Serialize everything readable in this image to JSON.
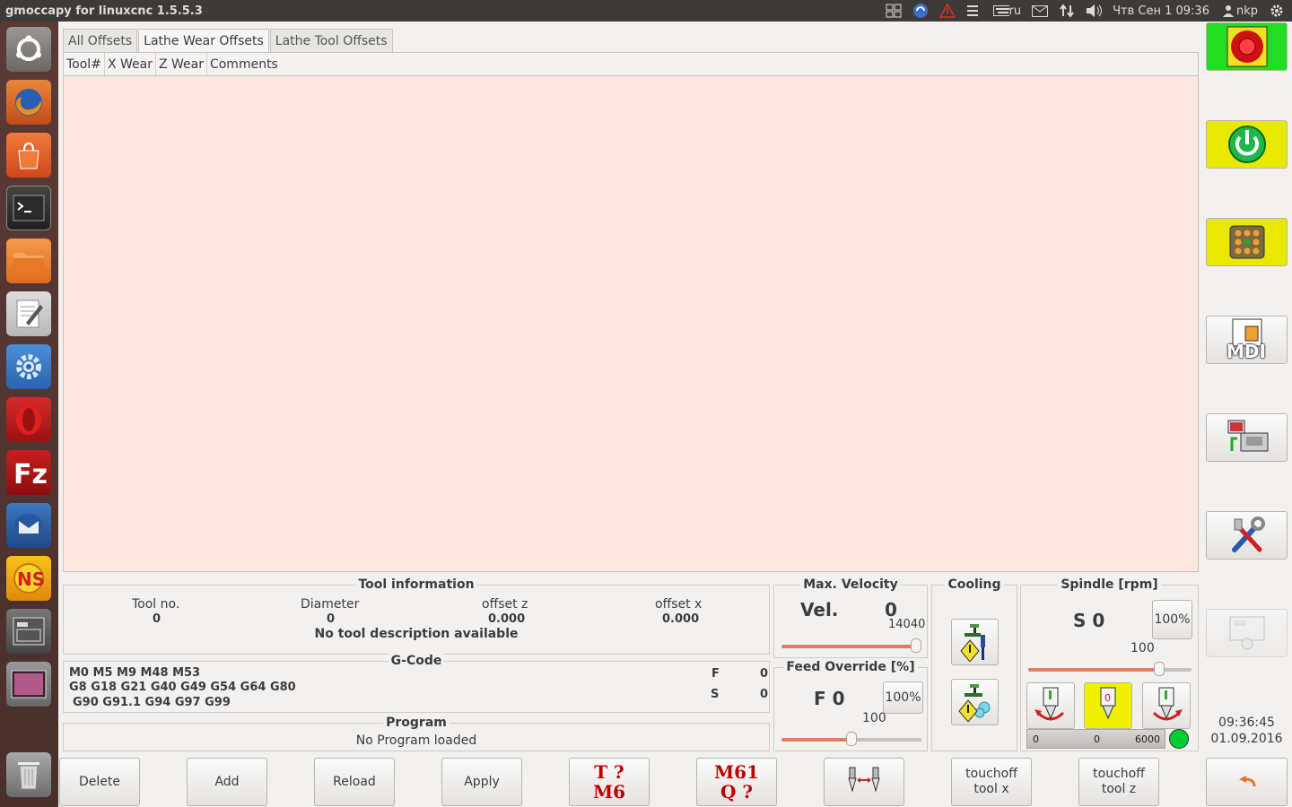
{
  "window": {
    "title": "gmoccapy for linuxcnc  1.5.5.3"
  },
  "tray": {
    "keyboard_layout": "ru",
    "datetime": "Чтв Сен  1 09:36",
    "user": "nkp"
  },
  "tabs": [
    {
      "label": "All Offsets"
    },
    {
      "label": "Lathe Wear Offsets"
    },
    {
      "label": "Lathe Tool Offsets"
    }
  ],
  "table": {
    "columns": [
      "Tool#",
      "X Wear",
      "Z Wear",
      "Comments"
    ]
  },
  "tool_info": {
    "title": "Tool information",
    "tool_no_label": "Tool no.",
    "tool_no": "0",
    "diameter_label": "Diameter",
    "diameter": "0",
    "offset_z_label": "offset z",
    "offset_z": "0.000",
    "offset_x_label": "offset x",
    "offset_x": "0.000",
    "description": "No tool description available"
  },
  "gcode": {
    "title": "G-Code",
    "line1": "M0 M5 M9 M48 M53",
    "line2": "G8 G18 G21 G40 G49 G54 G64 G80",
    "line3": "G90 G91.1 G94 G97 G99",
    "f_label": "F",
    "f_value": "0",
    "s_label": "S",
    "s_value": "0"
  },
  "program": {
    "title": "Program",
    "status": "No Program loaded"
  },
  "max_velocity": {
    "title": "Max. Velocity",
    "label": "Vel.",
    "value": "0",
    "max": "14040",
    "level": 1.0
  },
  "feed_override": {
    "title": "Feed Override [%]",
    "label": "F  0",
    "percent_button": "100%",
    "value": "100",
    "level": 0.5
  },
  "cooling": {
    "title": "Cooling"
  },
  "spindle": {
    "title": "Spindle [rpm]",
    "label": "S 0",
    "percent_button": "100%",
    "override_value": "100",
    "override_level": 0.8,
    "bar_min": "0",
    "bar_value": "0",
    "bar_max": "6000"
  },
  "bottom_buttons": {
    "delete": "Delete",
    "add": "Add",
    "reload": "Reload",
    "apply": "Apply",
    "t_line1": "T ?",
    "t_line2": "M6",
    "m61_line1": "M61",
    "m61_line2": "Q ?",
    "touchoff_x_line1": "touchoff",
    "touchoff_x_line2": "tool x",
    "touchoff_z_line1": "touchoff",
    "touchoff_z_line2": "tool z"
  },
  "right_buttons": {
    "mdi_label": "MDI"
  },
  "clock": {
    "time": "09:36:45",
    "date": "01.09.2016"
  },
  "colors": {
    "table_bg": "#fde8e0",
    "estop_bg": "#22dd22",
    "power_bg": "#e8e800",
    "active_yellow": "#f0f000",
    "status_led": "#00cc33"
  }
}
